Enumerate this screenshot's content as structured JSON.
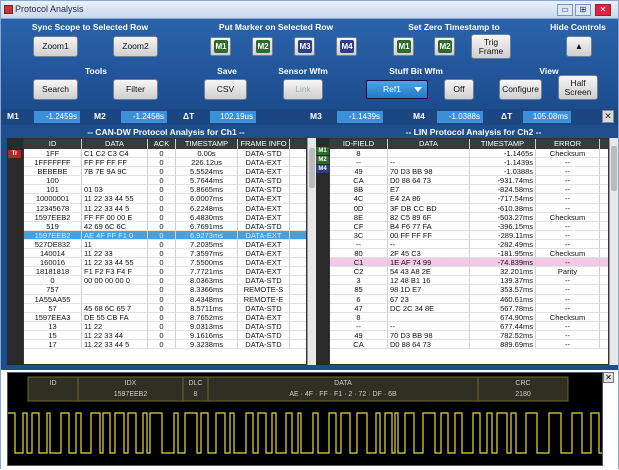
{
  "window": {
    "title": "Protocol Analysis",
    "btn_min": "▭",
    "btn_max": "⊞",
    "btn_close": "✕"
  },
  "controls": {
    "sync_scope": {
      "title": "Sync Scope to Selected Row",
      "zoom1": "Zoom1",
      "zoom2": "Zoom2"
    },
    "put_marker": {
      "title": "Put Marker on Selected Row",
      "m1": "M1",
      "m2": "M2",
      "m3": "M3",
      "m4": "M4"
    },
    "set_zero": {
      "title": "Set Zero Timestamp to",
      "m1": "M1",
      "m2": "M2",
      "trig_frame": "Trig Frame"
    },
    "hide_controls": {
      "title": "Hide Controls",
      "glyph": "▲"
    },
    "tools": {
      "title": "Tools",
      "search": "Search",
      "filter": "Filter"
    },
    "save": {
      "title": "Save",
      "csv": "CSV"
    },
    "sensor_wfm": {
      "title": "Sensor Wfm",
      "link": "Link"
    },
    "stuff_bit": {
      "title": "Stuff Bit Wfm",
      "ref": "Ref1",
      "off": "Off"
    },
    "view": {
      "title": "View",
      "configure": "Configure",
      "half_screen": "Half Screen"
    }
  },
  "markers": {
    "m1_label": "M1",
    "m1_value": "-1.2459s",
    "m2_label": "M2",
    "m2_value": "-1.2458s",
    "dt1_label": "ΔT",
    "dt1_value": "102.19us",
    "m3_label": "M3",
    "m3_value": "-1.1439s",
    "m4_label": "M4",
    "m4_value": "-1.0388s",
    "dt2_label": "ΔT",
    "dt2_value": "105.08ms",
    "close": "✕"
  },
  "can_panel": {
    "title": "-- CAN-DW Protocol Analysis for Ch1 --",
    "headers": [
      "ID",
      "DATA",
      "ACK",
      "TIMESTAMP",
      "FRAME INFO"
    ],
    "rows": [
      [
        "1FF",
        "C1 C2 C3 C4",
        "0",
        "0.00s",
        "DATA-STD"
      ],
      [
        "1FFFFFFF",
        "FF FF FF FF",
        "0",
        "226.12us",
        "DATA-EXT"
      ],
      [
        "BEBEBE",
        "7B 7E 9A 9C",
        "0",
        "5.5524ms",
        "DATA-EXT"
      ],
      [
        "100",
        "",
        "0",
        "5.7644ms",
        "DATA-STD"
      ],
      [
        "101",
        "01 03",
        "0",
        "5.8665ms",
        "DATA-STD"
      ],
      [
        "10000001",
        "11 22 33 44 55",
        "0",
        "6.0007ms",
        "DATA-EXT"
      ],
      [
        "12345678",
        "11 22 33 44 5",
        "0",
        "6.2248ms",
        "DATA-EXT"
      ],
      [
        "1597EEB2",
        "FF FF 00 00 E",
        "0",
        "6.4830ms",
        "DATA-EXT"
      ],
      [
        "519",
        "42 69 6C 6C",
        "0",
        "6.7691ms",
        "DATA-STD"
      ],
      [
        "1597EEB2",
        "AE 4F FF F1 0",
        "0",
        "6.9273ms",
        "DATA-EXT"
      ],
      [
        "527DE832",
        "11",
        "0",
        "7.2035ms",
        "DATA-EXT"
      ],
      [
        "140014",
        "11 22 33",
        "0",
        "7.3597ms",
        "DATA-EXT"
      ],
      [
        "160016",
        "11 22 33 44 55",
        "0",
        "7.5500ms",
        "DATA-EXT"
      ],
      [
        "18181818",
        "F1 F2 F3 F4 F",
        "0",
        "7.7721ms",
        "DATA-EXT"
      ],
      [
        "0",
        "00 00 00 00 0",
        "0",
        "8.0363ms",
        "DATA-STD"
      ],
      [
        "757",
        "",
        "0",
        "8.3366ms",
        "REMOTE-S"
      ],
      [
        "1A55AA55",
        "",
        "0",
        "8.4348ms",
        "REMOTE-E"
      ],
      [
        "57",
        "45 68 6C 65 7",
        "0",
        "8.5711ms",
        "DATA-STD"
      ],
      [
        "1597EEA3",
        "DE 55 CB FA",
        "0",
        "8.7652ms",
        "DATA-EXT"
      ],
      [
        "13",
        "11 22",
        "0",
        "9.0313ms",
        "DATA-STD"
      ],
      [
        "15",
        "11 22 33 44",
        "0",
        "9.1616ms",
        "DATA-STD"
      ],
      [
        "17",
        "11 22 33 44 5",
        "0",
        "9.3238ms",
        "DATA-STD"
      ]
    ],
    "selected_row": 9,
    "tags": {
      "trig": "Tr"
    }
  },
  "lin_panel": {
    "title": "-- LIN Protocol Analysis for Ch2 --",
    "headers": [
      "ID-FIELD",
      "DATA",
      "TIMESTAMP",
      "ERROR"
    ],
    "rows": [
      [
        "8",
        "",
        "-1.1465s",
        "Checksum"
      ],
      [
        "--",
        "--",
        "-1.1439s",
        "--"
      ],
      [
        "49",
        "70 D3 BB 98",
        "-1.0388s",
        "--"
      ],
      [
        "CA",
        "D0 88 64 73",
        "-931.74ms",
        "--"
      ],
      [
        "8B",
        "E7",
        "-824.58ms",
        "--"
      ],
      [
        "4C",
        "E4 2A 86",
        "-717.54ms",
        "--"
      ],
      [
        "0D",
        "3F DB CC BD",
        "-610.38ms",
        "--"
      ],
      [
        "8E",
        "82 C5 89 6F",
        "-503.27ms",
        "Checksum"
      ],
      [
        "CF",
        "B4 F6 77 FA",
        "-396.15ms",
        "--"
      ],
      [
        "3C",
        "00 FF FF FF",
        "-289.11ms",
        "--"
      ],
      [
        "--",
        "--",
        "-282.49ms",
        "--"
      ],
      [
        "80",
        "2F 45 C3",
        "-181.95ms",
        "Checksum"
      ],
      [
        "C1",
        "1E AF 74 99",
        "-74.839ms",
        "--"
      ],
      [
        "C2",
        "54 43 A8 2E",
        "32.201ms",
        "Parity"
      ],
      [
        "3",
        "12 48 B1 16",
        "139.37ms",
        "--"
      ],
      [
        "85",
        "98 1D E7",
        "353.57ms",
        "--"
      ],
      [
        "6",
        "67 23",
        "460.61ms",
        "--"
      ],
      [
        "47",
        "DC 2C 34 8E",
        "567.78ms",
        "--"
      ],
      [
        "8",
        "",
        "674.90ms",
        "Checksum"
      ],
      [
        "--",
        "--",
        "677.44ms",
        "--"
      ],
      [
        "49",
        "70 D3 BB 98",
        "782.52ms",
        "--"
      ],
      [
        "CA",
        "D0 88 64 73",
        "889.69ms",
        "--"
      ]
    ],
    "pink_row": 12,
    "tags": {
      "m1": "M1",
      "m2": "M2",
      "m4": "M4"
    }
  },
  "waveform": {
    "segments": [
      {
        "name": "ID",
        "value": ""
      },
      {
        "name": "IDX",
        "value": "1597EEB2"
      },
      {
        "name": "DLC",
        "value": "8"
      },
      {
        "name": "DATA",
        "value": "AE · 4F · FF · F1 · 2 · 72 · DF · 6B"
      },
      {
        "name": "CRC",
        "value": "2180"
      }
    ],
    "close": "✕"
  }
}
